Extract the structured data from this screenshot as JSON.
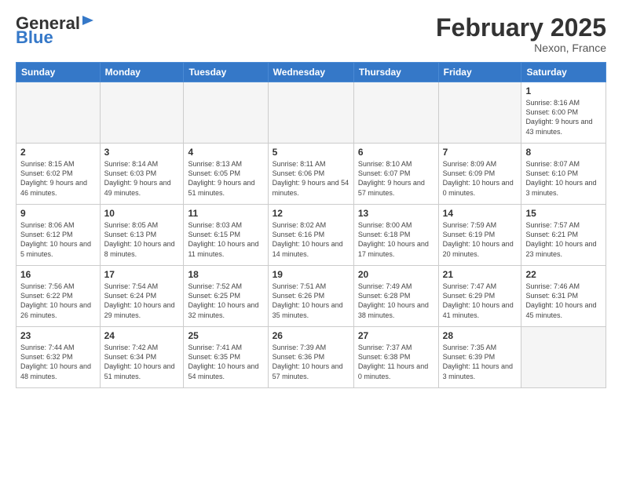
{
  "header": {
    "logo_general": "General",
    "logo_blue": "Blue",
    "month_title": "February 2025",
    "location": "Nexon, France"
  },
  "calendar": {
    "days_of_week": [
      "Sunday",
      "Monday",
      "Tuesday",
      "Wednesday",
      "Thursday",
      "Friday",
      "Saturday"
    ],
    "weeks": [
      [
        {
          "day": "",
          "info": ""
        },
        {
          "day": "",
          "info": ""
        },
        {
          "day": "",
          "info": ""
        },
        {
          "day": "",
          "info": ""
        },
        {
          "day": "",
          "info": ""
        },
        {
          "day": "",
          "info": ""
        },
        {
          "day": "1",
          "info": "Sunrise: 8:16 AM\nSunset: 6:00 PM\nDaylight: 9 hours and 43 minutes."
        }
      ],
      [
        {
          "day": "2",
          "info": "Sunrise: 8:15 AM\nSunset: 6:02 PM\nDaylight: 9 hours and 46 minutes."
        },
        {
          "day": "3",
          "info": "Sunrise: 8:14 AM\nSunset: 6:03 PM\nDaylight: 9 hours and 49 minutes."
        },
        {
          "day": "4",
          "info": "Sunrise: 8:13 AM\nSunset: 6:05 PM\nDaylight: 9 hours and 51 minutes."
        },
        {
          "day": "5",
          "info": "Sunrise: 8:11 AM\nSunset: 6:06 PM\nDaylight: 9 hours and 54 minutes."
        },
        {
          "day": "6",
          "info": "Sunrise: 8:10 AM\nSunset: 6:07 PM\nDaylight: 9 hours and 57 minutes."
        },
        {
          "day": "7",
          "info": "Sunrise: 8:09 AM\nSunset: 6:09 PM\nDaylight: 10 hours and 0 minutes."
        },
        {
          "day": "8",
          "info": "Sunrise: 8:07 AM\nSunset: 6:10 PM\nDaylight: 10 hours and 3 minutes."
        }
      ],
      [
        {
          "day": "9",
          "info": "Sunrise: 8:06 AM\nSunset: 6:12 PM\nDaylight: 10 hours and 5 minutes."
        },
        {
          "day": "10",
          "info": "Sunrise: 8:05 AM\nSunset: 6:13 PM\nDaylight: 10 hours and 8 minutes."
        },
        {
          "day": "11",
          "info": "Sunrise: 8:03 AM\nSunset: 6:15 PM\nDaylight: 10 hours and 11 minutes."
        },
        {
          "day": "12",
          "info": "Sunrise: 8:02 AM\nSunset: 6:16 PM\nDaylight: 10 hours and 14 minutes."
        },
        {
          "day": "13",
          "info": "Sunrise: 8:00 AM\nSunset: 6:18 PM\nDaylight: 10 hours and 17 minutes."
        },
        {
          "day": "14",
          "info": "Sunrise: 7:59 AM\nSunset: 6:19 PM\nDaylight: 10 hours and 20 minutes."
        },
        {
          "day": "15",
          "info": "Sunrise: 7:57 AM\nSunset: 6:21 PM\nDaylight: 10 hours and 23 minutes."
        }
      ],
      [
        {
          "day": "16",
          "info": "Sunrise: 7:56 AM\nSunset: 6:22 PM\nDaylight: 10 hours and 26 minutes."
        },
        {
          "day": "17",
          "info": "Sunrise: 7:54 AM\nSunset: 6:24 PM\nDaylight: 10 hours and 29 minutes."
        },
        {
          "day": "18",
          "info": "Sunrise: 7:52 AM\nSunset: 6:25 PM\nDaylight: 10 hours and 32 minutes."
        },
        {
          "day": "19",
          "info": "Sunrise: 7:51 AM\nSunset: 6:26 PM\nDaylight: 10 hours and 35 minutes."
        },
        {
          "day": "20",
          "info": "Sunrise: 7:49 AM\nSunset: 6:28 PM\nDaylight: 10 hours and 38 minutes."
        },
        {
          "day": "21",
          "info": "Sunrise: 7:47 AM\nSunset: 6:29 PM\nDaylight: 10 hours and 41 minutes."
        },
        {
          "day": "22",
          "info": "Sunrise: 7:46 AM\nSunset: 6:31 PM\nDaylight: 10 hours and 45 minutes."
        }
      ],
      [
        {
          "day": "23",
          "info": "Sunrise: 7:44 AM\nSunset: 6:32 PM\nDaylight: 10 hours and 48 minutes."
        },
        {
          "day": "24",
          "info": "Sunrise: 7:42 AM\nSunset: 6:34 PM\nDaylight: 10 hours and 51 minutes."
        },
        {
          "day": "25",
          "info": "Sunrise: 7:41 AM\nSunset: 6:35 PM\nDaylight: 10 hours and 54 minutes."
        },
        {
          "day": "26",
          "info": "Sunrise: 7:39 AM\nSunset: 6:36 PM\nDaylight: 10 hours and 57 minutes."
        },
        {
          "day": "27",
          "info": "Sunrise: 7:37 AM\nSunset: 6:38 PM\nDaylight: 11 hours and 0 minutes."
        },
        {
          "day": "28",
          "info": "Sunrise: 7:35 AM\nSunset: 6:39 PM\nDaylight: 11 hours and 3 minutes."
        },
        {
          "day": "",
          "info": ""
        }
      ]
    ]
  }
}
